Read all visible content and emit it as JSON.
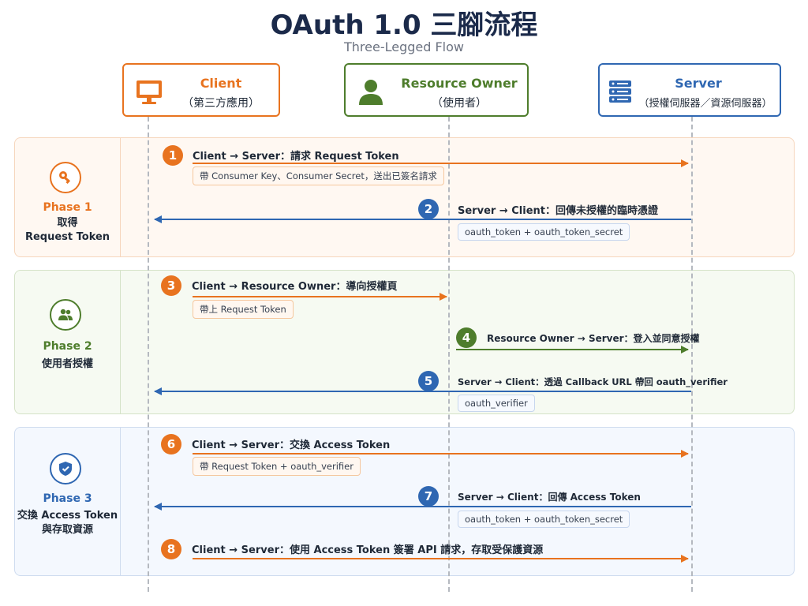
{
  "title": "OAuth 1.0 三腳流程",
  "subtitle": "Three-Legged Flow",
  "actors": {
    "client": {
      "name": "Client",
      "sub": "（第三方應用）",
      "icon": "monitor-icon"
    },
    "owner": {
      "name": "Resource Owner",
      "sub": "（使用者）",
      "icon": "user-icon"
    },
    "server": {
      "name": "Server",
      "sub": "（授權伺服器／資源伺服器）",
      "icon": "server-icon"
    }
  },
  "phases": [
    {
      "name": "Phase 1",
      "desc1": "取得",
      "desc2": "Request Token",
      "icon": "key-icon"
    },
    {
      "name": "Phase 2",
      "desc1": "使用者授權",
      "desc2": "",
      "icon": "users-icon"
    },
    {
      "name": "Phase 3",
      "desc1": "交換 Access Token",
      "desc2": "與存取資源",
      "icon": "shield-icon"
    }
  ],
  "steps": [
    {
      "num": "1",
      "label": "Client → Server：請求 Request Token",
      "note": "帶 Consumer Key、Consumer Secret，送出已簽名請求"
    },
    {
      "num": "2",
      "label": "Server → Client：回傳未授權的臨時憑證",
      "note": "oauth_token + oauth_token_secret"
    },
    {
      "num": "3",
      "label": "Client → Resource Owner：導向授權頁",
      "note": "帶上 Request Token"
    },
    {
      "num": "4",
      "label": "Resource Owner → Server：登入並同意授權",
      "note": ""
    },
    {
      "num": "5",
      "label": "Server → Client：透過 Callback URL 帶回 oauth_verifier",
      "note": "oauth_verifier"
    },
    {
      "num": "6",
      "label": "Client → Server：交換 Access Token",
      "note": "帶 Request Token + oauth_verifier"
    },
    {
      "num": "7",
      "label": "Server → Client：回傳 Access Token",
      "note": "oauth_token + oauth_token_secret"
    },
    {
      "num": "8",
      "label": "Client → Server：使用 Access Token 簽署 API 請求，存取受保護資源",
      "note": ""
    }
  ],
  "colors": {
    "client": "#e8731f",
    "owner": "#4e7d2c",
    "server": "#2f67b2",
    "phase1_bg": "#fff8f2",
    "phase2_bg": "#f6faf2",
    "phase3_bg": "#f4f8fe"
  }
}
